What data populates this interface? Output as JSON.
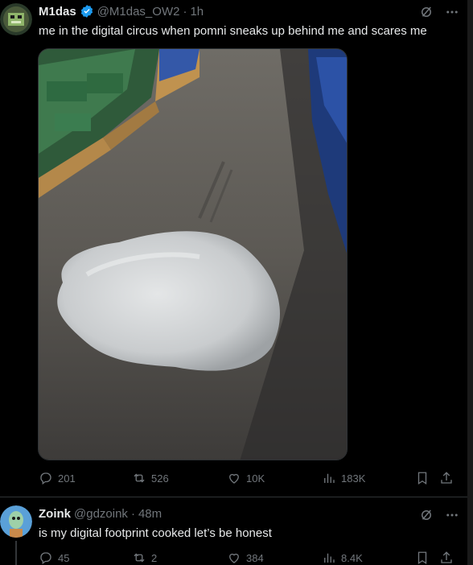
{
  "tweet1": {
    "name": "M1das",
    "handle": "@M1das_OW2",
    "sep": "·",
    "time": "1h",
    "text": "me in the digital circus when pomni sneaks up behind me and scares me",
    "stats": {
      "replies": "201",
      "reposts": "526",
      "likes": "10K",
      "views": "183K"
    }
  },
  "tweet2": {
    "name": "Zoink",
    "handle": "@gdzoink",
    "sep": "·",
    "time": "48m",
    "text": "is my digital footprint cooked let’s be honest",
    "stats": {
      "replies": "45",
      "reposts": "2",
      "likes": "384",
      "views": "8.4K"
    }
  },
  "colors": {
    "accent": "#1d9bf0",
    "muted": "#71767b",
    "text": "#e7e9ea"
  },
  "icons": [
    "verified-badge-icon",
    "grok-icon",
    "more-icon",
    "reply-icon",
    "repost-icon",
    "like-icon",
    "views-icon",
    "bookmark-icon",
    "share-icon"
  ]
}
